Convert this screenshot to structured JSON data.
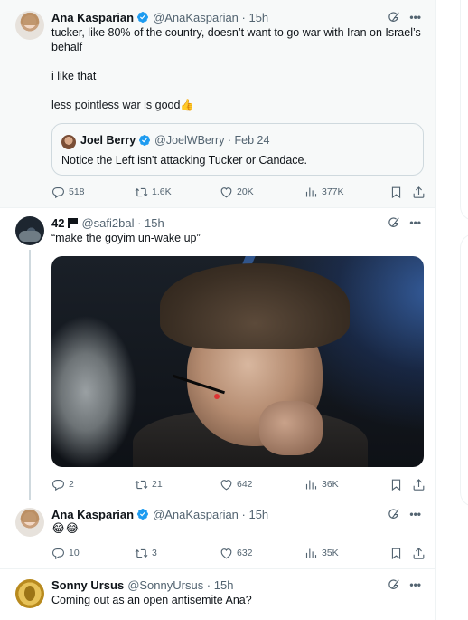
{
  "colors": {
    "verified": "#1d9bf0",
    "muted": "#536471",
    "border": "#eff3f4"
  },
  "tweets": [
    {
      "name": "Ana Kasparian",
      "handle": "@AnaKasparian · 15h",
      "verified": true,
      "lines": [
        "tucker, like 80% of the country, doesn’t want to go war with Iran on Israel’s behalf",
        "i like that",
        "less pointless war is good👍"
      ],
      "quote": {
        "name": "Joel Berry",
        "handle": "@JoelWBerry · Feb 24",
        "text": "Notice the Left isn't attacking Tucker or Candace."
      },
      "stats": {
        "replies": "518",
        "reposts": "1.6K",
        "likes": "20K",
        "views": "377K"
      }
    },
    {
      "name": "42",
      "handle": "@safi2bal · 15h",
      "verified": false,
      "text": "“make the goyim un-wake up”",
      "stats": {
        "replies": "2",
        "reposts": "21",
        "likes": "642",
        "views": "36K"
      }
    },
    {
      "name": "Ana Kasparian",
      "handle": "@AnaKasparian · 15h",
      "verified": true,
      "text": "😂😂",
      "stats": {
        "replies": "10",
        "reposts": "3",
        "likes": "632",
        "views": "35K"
      }
    },
    {
      "name": "Sonny Ursus",
      "handle": "@SonnyUrsus · 15h",
      "verified": false,
      "text": "Coming out as an open antisemite Ana?"
    }
  ]
}
